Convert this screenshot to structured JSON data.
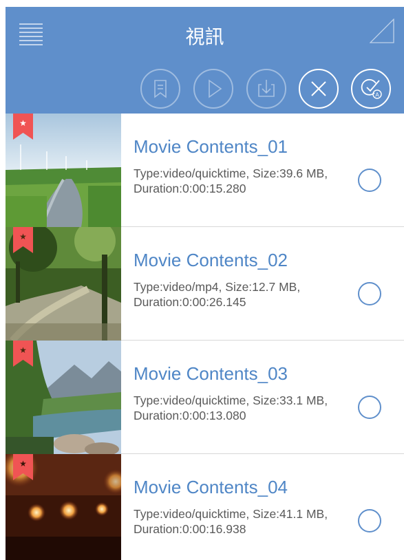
{
  "header": {
    "title": "視訊",
    "menu_icon": "hamburger-menu-icon",
    "corner_icon": "corner-triangle-icon",
    "background_color": "#5f8fcb"
  },
  "toolbar": [
    {
      "icon": "bookmark-icon",
      "enabled": false
    },
    {
      "icon": "play-icon",
      "enabled": false
    },
    {
      "icon": "download-icon",
      "enabled": false
    },
    {
      "icon": "close-icon",
      "enabled": true
    },
    {
      "icon": "select-all-icon",
      "enabled": true
    }
  ],
  "videos": [
    {
      "title": "Movie Contents_01",
      "meta": "Type:video/quicktime, Size:39.6 MB, Duration:0:00:15.280",
      "favorite": true,
      "selected": false
    },
    {
      "title": "Movie Contents_02",
      "meta": "Type:video/mp4, Size:12.7 MB, Duration:0:00:26.145",
      "favorite": true,
      "selected": false
    },
    {
      "title": "Movie Contents_03",
      "meta": "Type:video/quicktime, Size:33.1 MB, Duration:0:00:13.080",
      "favorite": true,
      "selected": false
    },
    {
      "title": "Movie Contents_04",
      "meta": "Type:video/quicktime, Size:41.1 MB, Duration:0:00:16.938",
      "favorite": true,
      "selected": false
    }
  ],
  "colors": {
    "accent": "#4f86c6",
    "ribbon": "#f05454",
    "divider": "#d7d7d7"
  }
}
